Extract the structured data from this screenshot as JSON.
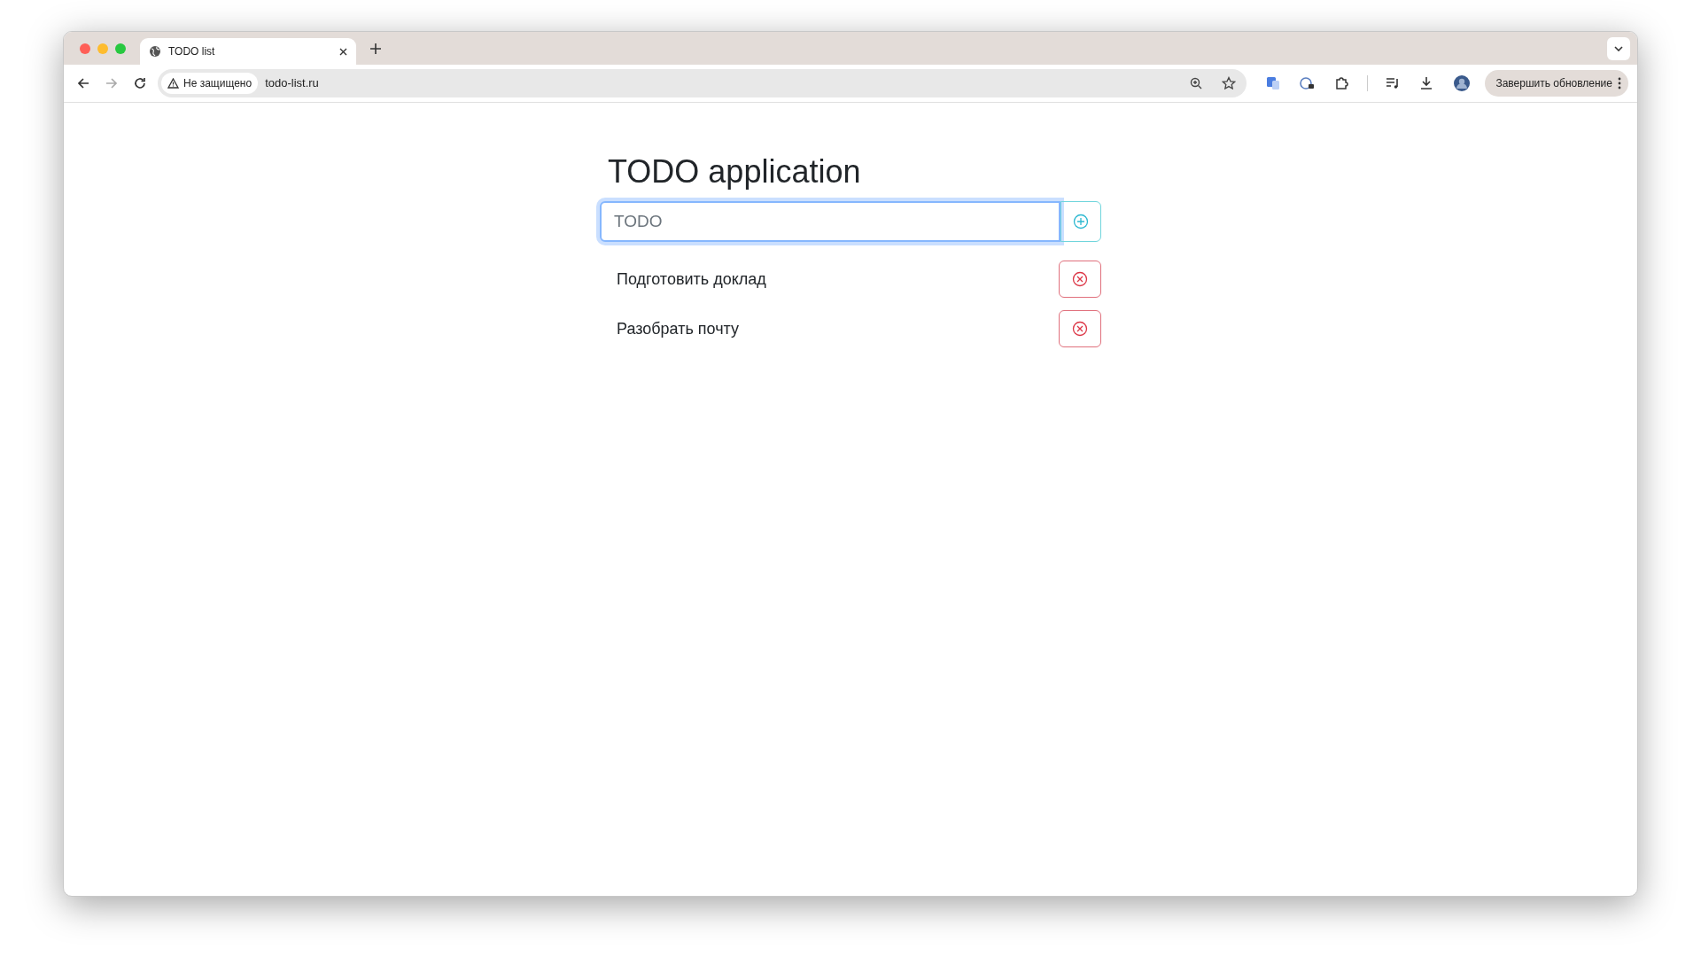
{
  "browser": {
    "tabs": [
      {
        "title": "TODO list",
        "selected": true
      }
    ],
    "security_label": "Не защищено",
    "url": "todo-list.ru",
    "update_button": "Завершить обновление"
  },
  "app": {
    "title": "TODO application",
    "input": {
      "placeholder": "TODO",
      "focused": true
    },
    "todos": [
      {
        "text": "Подготовить доклад"
      },
      {
        "text": "Разобрать почту"
      }
    ]
  }
}
